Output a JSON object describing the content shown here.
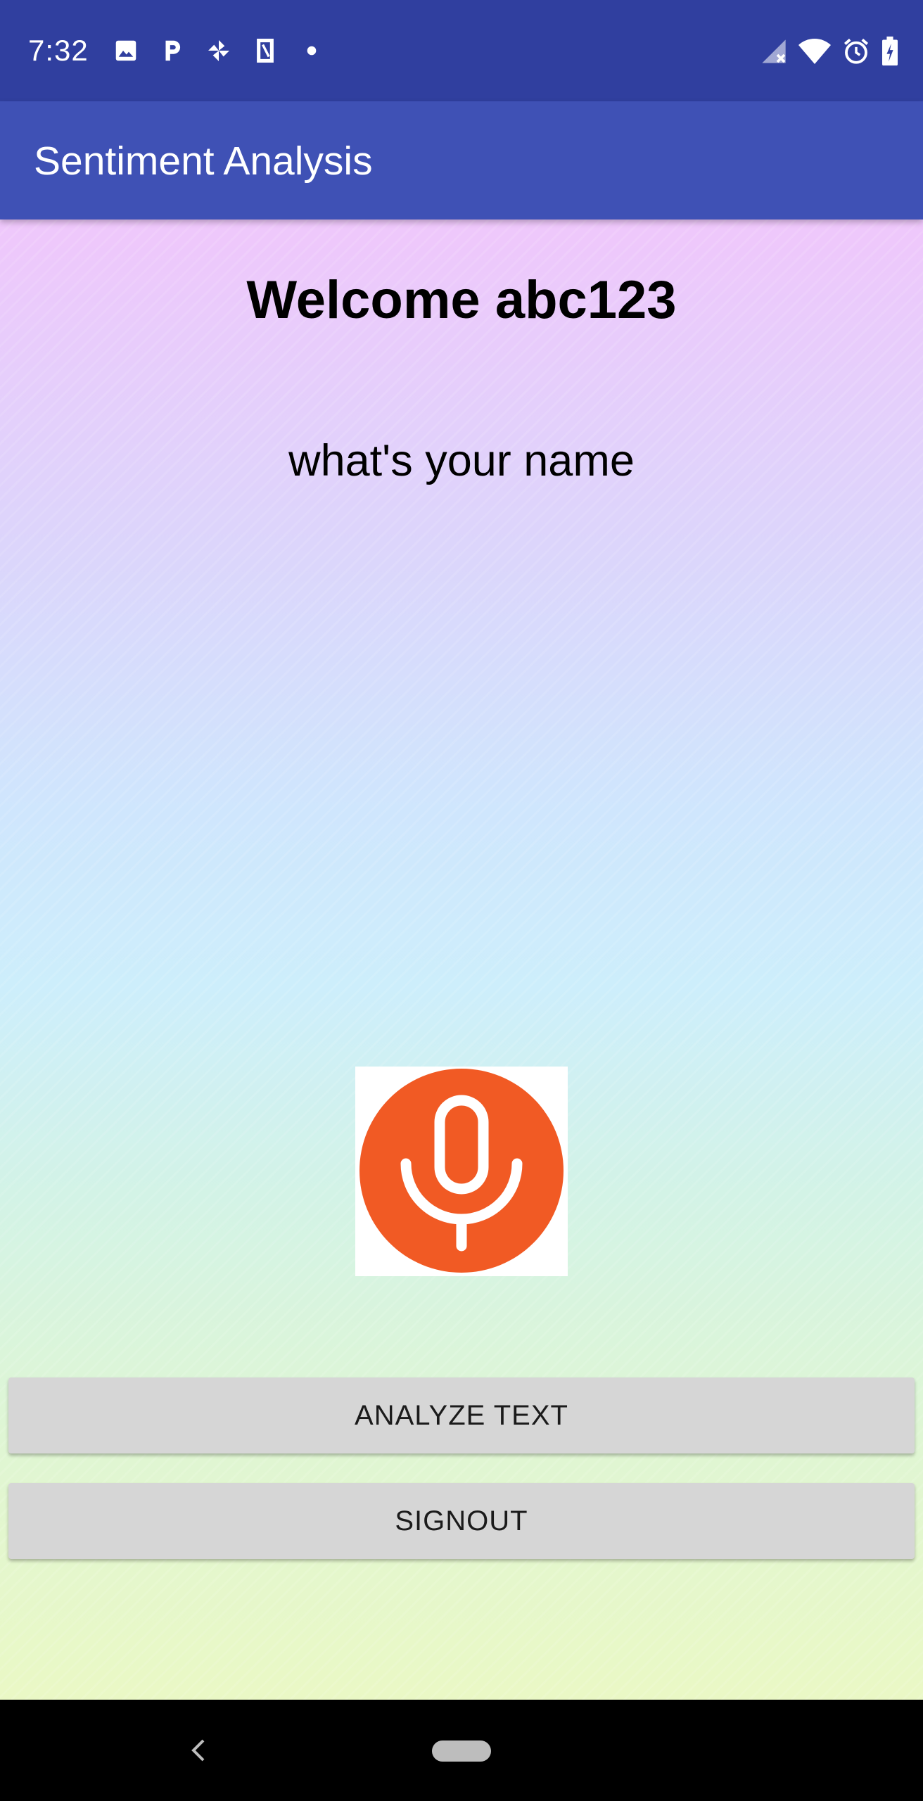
{
  "status_bar": {
    "time": "7:32",
    "left_icons": [
      "image-icon",
      "parking-icon",
      "pinwheel-icon",
      "sim-card-icon",
      "dot-icon"
    ],
    "right_icons": [
      "no-signal-icon",
      "wifi-icon",
      "alarm-icon",
      "battery-charging-icon"
    ],
    "background": "#303f9f"
  },
  "app_bar": {
    "title": "Sentiment Analysis",
    "background": "#3f51b5"
  },
  "main": {
    "welcome_text": "Welcome abc123",
    "prompt_text": "what's your name",
    "mic_button": {
      "icon": "microphone-icon",
      "color": "#f15a24"
    },
    "analyze_button_label": "ANALYZE TEXT",
    "signout_button_label": "SIGNOUT"
  },
  "nav_bar": {
    "icons": [
      "back-icon",
      "home-pill-icon"
    ]
  }
}
